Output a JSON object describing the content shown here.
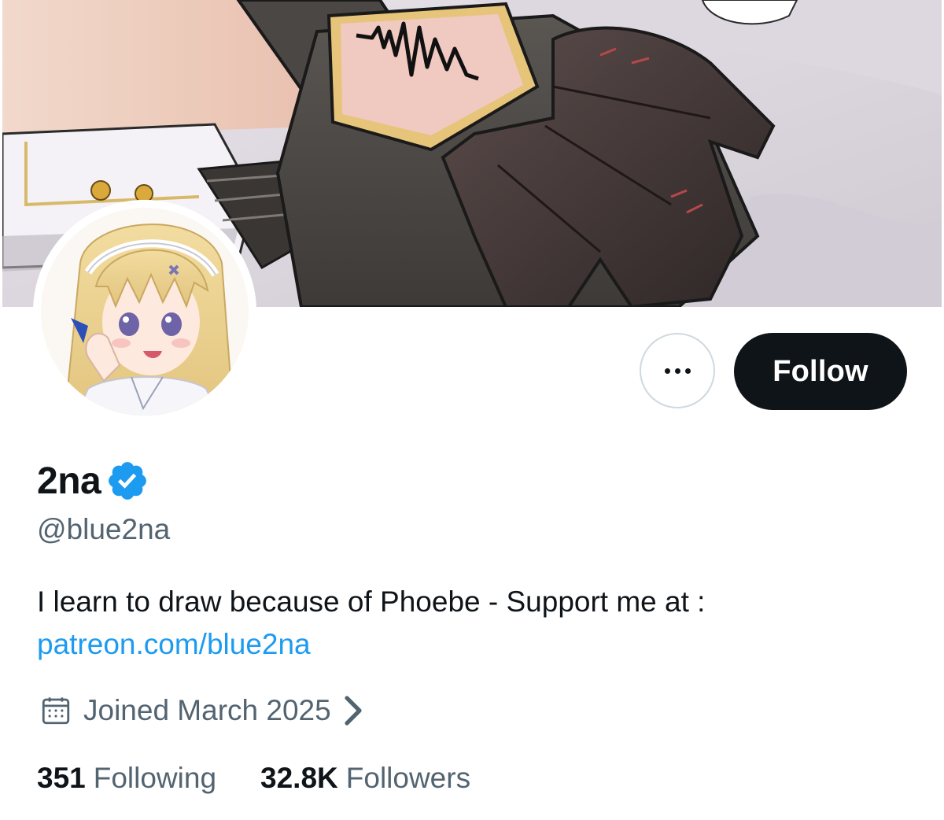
{
  "profile": {
    "display_name": "2na",
    "handle": "@blue2na",
    "verified": true,
    "bio_text": "I learn to draw because of Phoebe - Support me at :",
    "bio_link": "patreon.com/blue2na",
    "joined": "Joined March 2025",
    "following_count": "351",
    "following_label": "Following",
    "followers_count": "32.8K",
    "followers_label": "Followers"
  },
  "actions": {
    "follow_label": "Follow",
    "more_icon": "more-options-icon"
  },
  "icons": {
    "verified": "verified-badge-icon",
    "calendar": "calendar-icon",
    "chevron": "chevron-right-icon"
  },
  "colors": {
    "primary_text": "#0f1419",
    "secondary_text": "#536471",
    "link": "#1d9bf0",
    "verified": "#1d9bf0",
    "follow_button_bg": "#0f1419",
    "border": "#cfd9de"
  }
}
